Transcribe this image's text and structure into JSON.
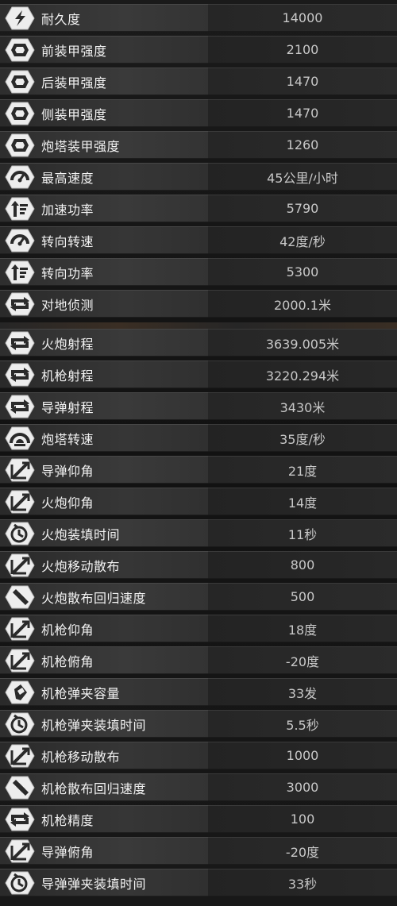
{
  "stats_group_1": [
    {
      "label": "耐久度",
      "value": "14000",
      "icon": "durability-icon"
    },
    {
      "label": "前装甲强度",
      "value": "2100",
      "icon": "armor-icon"
    },
    {
      "label": "后装甲强度",
      "value": "1470",
      "icon": "armor-icon"
    },
    {
      "label": "侧装甲强度",
      "value": "1470",
      "icon": "armor-icon"
    },
    {
      "label": "炮塔装甲强度",
      "value": "1260",
      "icon": "armor-icon"
    },
    {
      "label": "最高速度",
      "value": "45公里/小时",
      "icon": "speedometer-icon"
    },
    {
      "label": "加速功率",
      "value": "5790",
      "icon": "power-up-icon"
    },
    {
      "label": "转向转速",
      "value": "42度/秒",
      "icon": "speedometer-icon"
    },
    {
      "label": "转向功率",
      "value": "5300",
      "icon": "power-up-icon"
    },
    {
      "label": "对地侦测",
      "value": "2000.1米",
      "icon": "range-arrow-icon"
    }
  ],
  "stats_group_2": [
    {
      "label": "火炮射程",
      "value": "3639.005米",
      "icon": "range-arrow-icon"
    },
    {
      "label": "机枪射程",
      "value": "3220.294米",
      "icon": "range-arrow-icon"
    },
    {
      "label": "导弹射程",
      "value": "3430米",
      "icon": "range-arrow-icon"
    },
    {
      "label": "炮塔转速",
      "value": "35度/秒",
      "icon": "turret-rotation-icon"
    },
    {
      "label": "导弹仰角",
      "value": "21度",
      "icon": "angle-icon"
    },
    {
      "label": "火炮仰角",
      "value": "14度",
      "icon": "angle-icon"
    },
    {
      "label": "火炮装填时间",
      "value": "11秒",
      "icon": "reload-timer-icon"
    },
    {
      "label": "火炮移动散布",
      "value": "800",
      "icon": "angle-icon"
    },
    {
      "label": "火炮散布回归速度",
      "value": "500",
      "icon": "shell-icon"
    },
    {
      "label": "机枪仰角",
      "value": "18度",
      "icon": "angle-icon"
    },
    {
      "label": "机枪俯角",
      "value": "-20度",
      "icon": "angle-icon"
    },
    {
      "label": "机枪弹夹容量",
      "value": "33发",
      "icon": "bullet-icon"
    },
    {
      "label": "机枪弹夹装填时间",
      "value": "5.5秒",
      "icon": "reload-timer-icon"
    },
    {
      "label": "机枪移动散布",
      "value": "1000",
      "icon": "angle-icon"
    },
    {
      "label": "机枪散布回归速度",
      "value": "3000",
      "icon": "shell-icon"
    },
    {
      "label": "机枪精度",
      "value": "100",
      "icon": "range-arrow-icon"
    },
    {
      "label": "导弹俯角",
      "value": "-20度",
      "icon": "angle-icon"
    },
    {
      "label": "导弹弹夹装填时间",
      "value": "33秒",
      "icon": "reload-timer-icon"
    }
  ]
}
